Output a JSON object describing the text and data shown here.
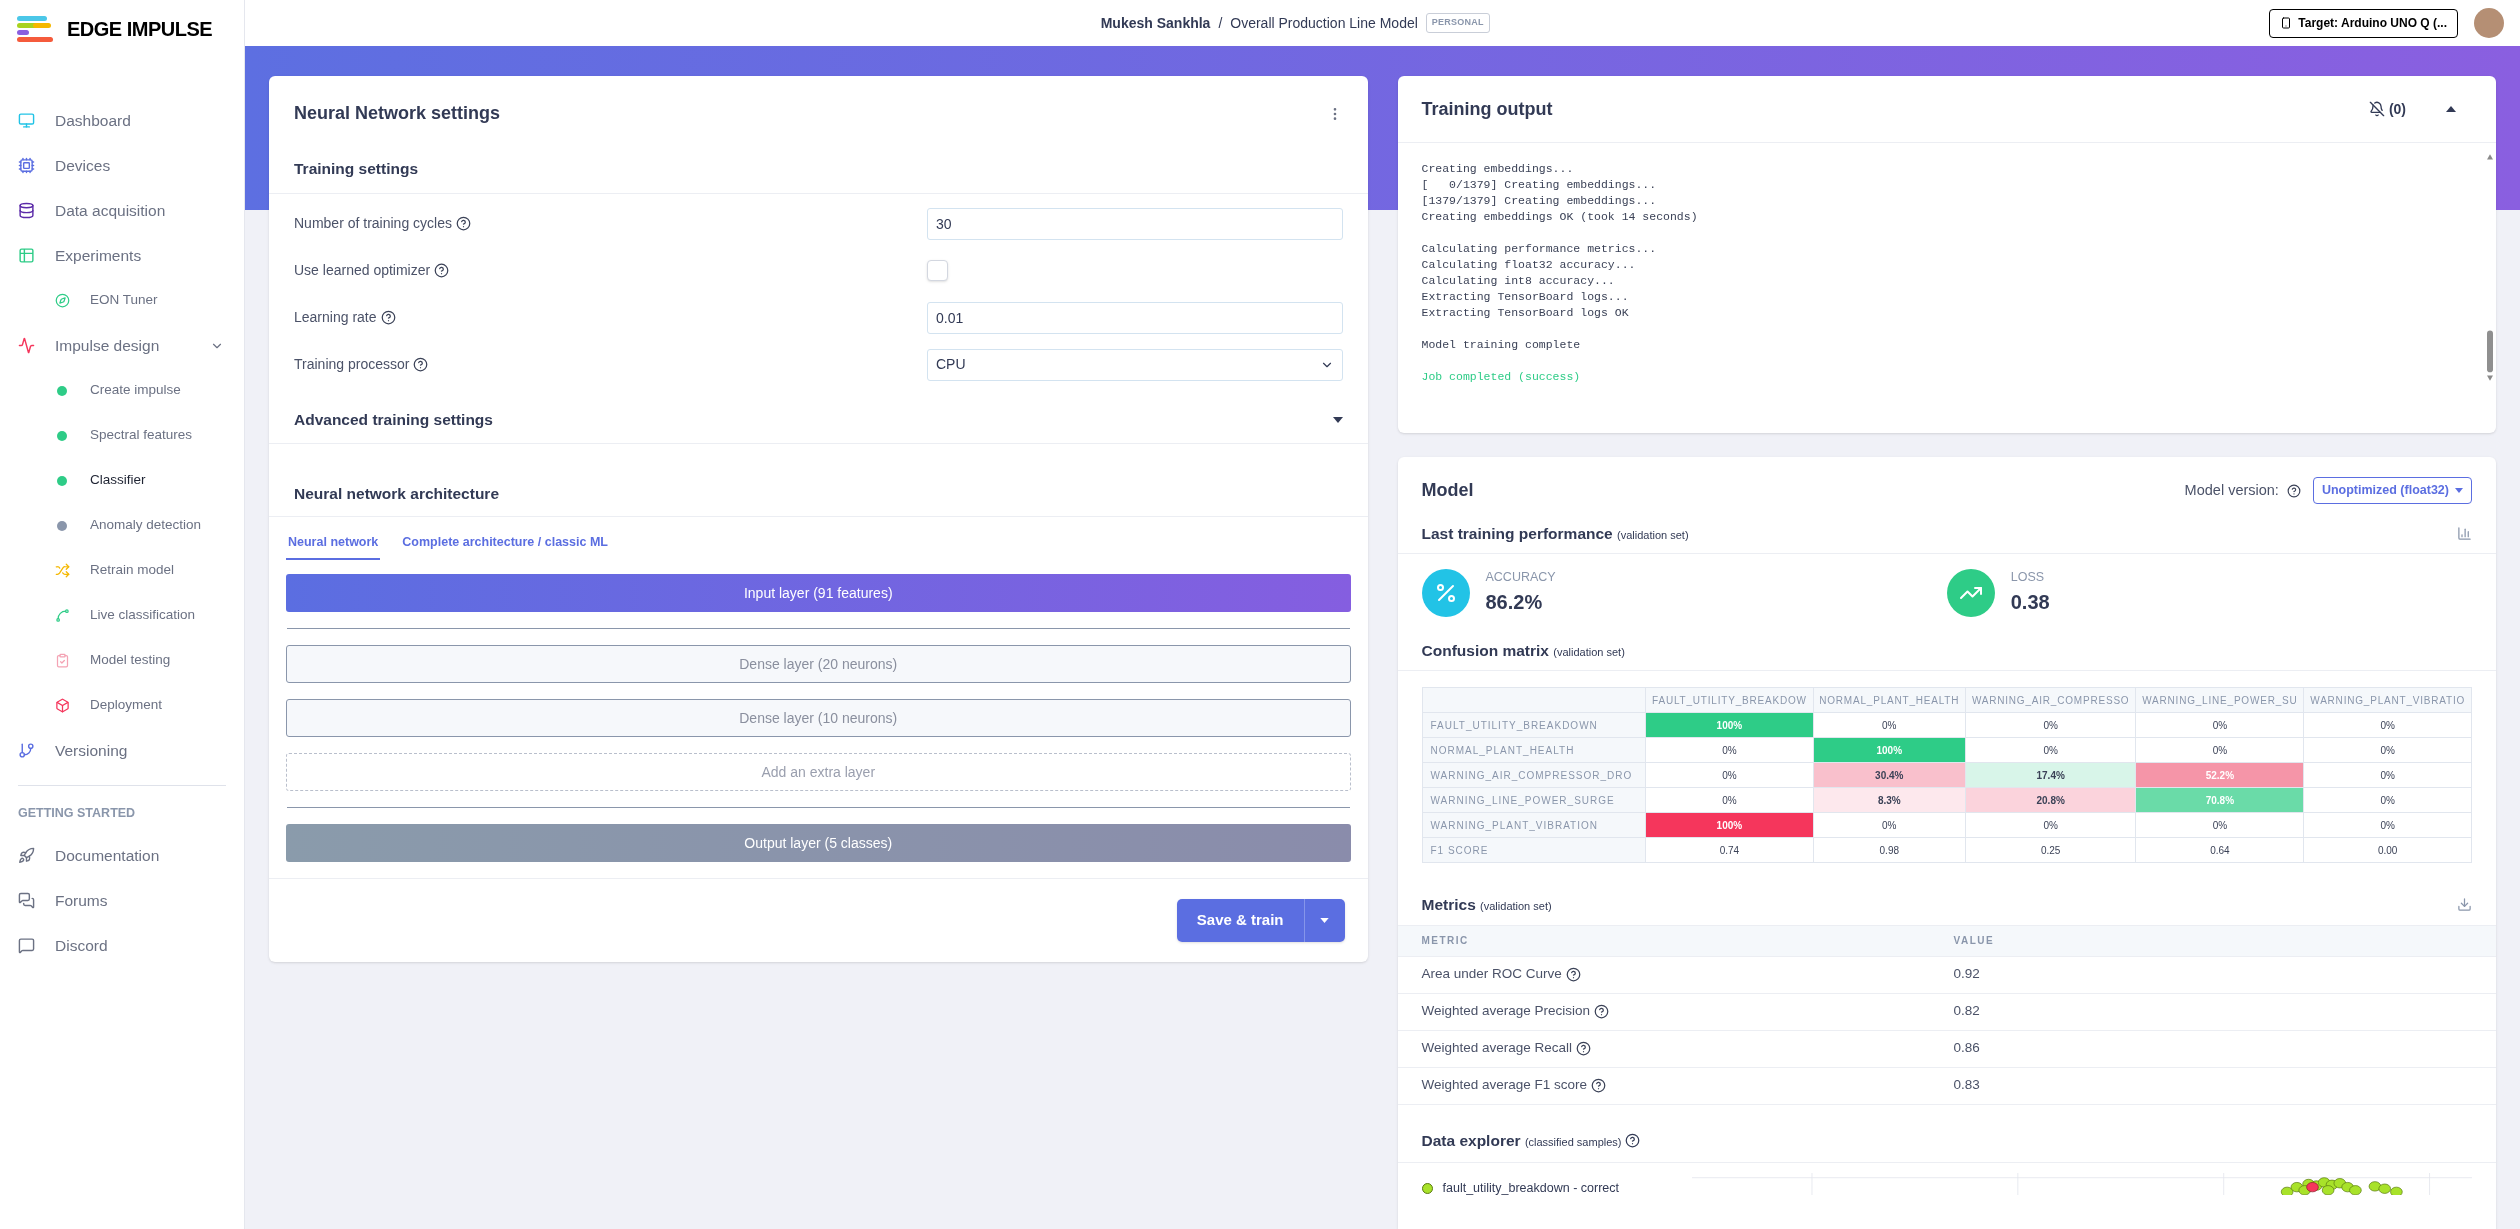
{
  "brand": {
    "name": "EDGE IMPULSE"
  },
  "header": {
    "owner": "Mukesh Sankhla",
    "separator": "/",
    "project": "Overall Production Line Model",
    "badge": "PERSONAL",
    "target_button": "Target: Arduino UNO Q (..."
  },
  "sidebar": {
    "items": [
      {
        "label": "Dashboard",
        "selected": false
      },
      {
        "label": "Devices",
        "selected": false
      },
      {
        "label": "Data acquisition",
        "selected": false
      },
      {
        "label": "Experiments",
        "selected": false,
        "children": [
          {
            "label": "EON Tuner",
            "kind": "icon",
            "selected": false
          }
        ]
      },
      {
        "label": "Impulse design",
        "selected": false,
        "expanded": true,
        "children": [
          {
            "label": "Create impulse",
            "kind": "dot",
            "color": "#2ecc87",
            "selected": false
          },
          {
            "label": "Spectral features",
            "kind": "dot",
            "color": "#2ecc87",
            "selected": false
          },
          {
            "label": "Classifier",
            "kind": "dot",
            "color": "#2ecc87",
            "selected": true
          },
          {
            "label": "Anomaly detection",
            "kind": "dot",
            "color": "#8a96ab",
            "selected": false
          },
          {
            "label": "Retrain model",
            "kind": "icon",
            "selected": false
          },
          {
            "label": "Live classification",
            "kind": "icon",
            "selected": false
          },
          {
            "label": "Model testing",
            "kind": "icon",
            "selected": false
          },
          {
            "label": "Deployment",
            "kind": "icon",
            "selected": false
          }
        ]
      },
      {
        "label": "Versioning",
        "selected": false
      }
    ],
    "section_heading": "GETTING STARTED",
    "help_items": [
      {
        "label": "Documentation"
      },
      {
        "label": "Forums"
      },
      {
        "label": "Discord"
      }
    ]
  },
  "nn_settings": {
    "title": "Neural Network settings",
    "training_settings": {
      "title": "Training settings",
      "fields": [
        {
          "kind": "input",
          "label": "Number of training cycles",
          "value": "30"
        },
        {
          "kind": "checkbox",
          "label": "Use learned optimizer",
          "checked": false
        },
        {
          "kind": "input",
          "label": "Learning rate",
          "value": "0.01"
        },
        {
          "kind": "select",
          "label": "Training processor",
          "value": "CPU"
        }
      ]
    },
    "advanced": {
      "title": "Advanced training settings",
      "expanded": false
    },
    "architecture": {
      "title": "Neural network architecture",
      "tabs": [
        {
          "label": "Neural network",
          "selected": true
        },
        {
          "label": "Complete architecture / classic ML",
          "selected": false
        }
      ],
      "layers": [
        {
          "kind": "input",
          "label": "Input layer (91 features)"
        },
        {
          "kind": "dense",
          "label": "Dense layer (20 neurons)"
        },
        {
          "kind": "dense",
          "label": "Dense layer (10 neurons)"
        },
        {
          "kind": "add",
          "label": "Add an extra layer"
        },
        {
          "kind": "output",
          "label": "Output layer (5 classes)"
        }
      ]
    },
    "save_button": "Save & train"
  },
  "training_output": {
    "title": "Training output",
    "notifications": "(0)",
    "expanded": true,
    "log_blocks": [
      [
        "Creating embeddings...",
        "[   0/1379] Creating embeddings...",
        "[1379/1379] Creating embeddings...",
        "Creating embeddings OK (took 14 seconds)"
      ],
      [
        "Calculating performance metrics...",
        "Calculating float32 accuracy...",
        "Calculating int8 accuracy...",
        "Extracting TensorBoard logs...",
        "Extracting TensorBoard logs OK"
      ],
      [
        "Model training complete"
      ]
    ],
    "status_line": "Job completed (success)"
  },
  "model": {
    "title": "Model",
    "version_label": "Model version:",
    "version": "Unoptimized (float32)",
    "last_training": {
      "title": "Last training performance",
      "note": "(validation set)",
      "stats": [
        {
          "label": "ACCURACY",
          "value": "86.2%"
        },
        {
          "label": "LOSS",
          "value": "0.38"
        }
      ]
    },
    "confusion": {
      "title": "Confusion matrix",
      "note": "(validation set)",
      "columns": [
        "FAULT_UTILITY_BREAKDOW",
        "NORMAL_PLANT_HEALTH",
        "WARNING_AIR_COMPRESSO",
        "WARNING_LINE_POWER_SU",
        "WARNING_PLANT_VIBRATIO"
      ],
      "rows": [
        {
          "label": "FAULT_UTILITY_BREAKDOWN",
          "cells": [
            {
              "text": "100%",
              "color": "#2ecc87"
            },
            {
              "text": "0%"
            },
            {
              "text": "0%"
            },
            {
              "text": "0%"
            },
            {
              "text": "0%"
            }
          ]
        },
        {
          "label": "NORMAL_PLANT_HEALTH",
          "cells": [
            {
              "text": "0%"
            },
            {
              "text": "100%",
              "color": "#2ecc87"
            },
            {
              "text": "0%"
            },
            {
              "text": "0%"
            },
            {
              "text": "0%"
            }
          ]
        },
        {
          "label": "WARNING_AIR_COMPRESSOR_DRO",
          "cells": [
            {
              "text": "0%"
            },
            {
              "text": "30.4%",
              "color": "#f9c0cc"
            },
            {
              "text": "17.4%",
              "color": "#d8f5e9"
            },
            {
              "text": "52.2%",
              "color": "#f595a8"
            },
            {
              "text": "0%"
            }
          ]
        },
        {
          "label": "WARNING_LINE_POWER_SURGE",
          "cells": [
            {
              "text": "0%"
            },
            {
              "text": "8.3%",
              "color": "#fde8ed"
            },
            {
              "text": "20.8%",
              "color": "#fbd3dc"
            },
            {
              "text": "70.8%",
              "color": "#6adba8"
            },
            {
              "text": "0%"
            }
          ]
        },
        {
          "label": "WARNING_PLANT_VIBRATION",
          "cells": [
            {
              "text": "100%",
              "color": "#f5365c"
            },
            {
              "text": "0%"
            },
            {
              "text": "0%"
            },
            {
              "text": "0%"
            },
            {
              "text": "0%"
            }
          ]
        },
        {
          "label": "F1 SCORE",
          "cells": [
            {
              "text": "0.74"
            },
            {
              "text": "0.98"
            },
            {
              "text": "0.25"
            },
            {
              "text": "0.64"
            },
            {
              "text": "0.00"
            }
          ]
        }
      ]
    },
    "metrics": {
      "title": "Metrics",
      "note": "(validation set)",
      "columns": [
        "METRIC",
        "VALUE"
      ],
      "rows": [
        {
          "metric": "Area under ROC Curve",
          "value": "0.92"
        },
        {
          "metric": "Weighted average Precision",
          "value": "0.82"
        },
        {
          "metric": "Weighted average Recall",
          "value": "0.86"
        },
        {
          "metric": "Weighted average F1 score",
          "value": "0.83"
        }
      ]
    },
    "data_explorer": {
      "title": "Data explorer",
      "note": "(classified samples)",
      "legend": [
        "fault_utility_breakdown - correct"
      ]
    }
  }
}
